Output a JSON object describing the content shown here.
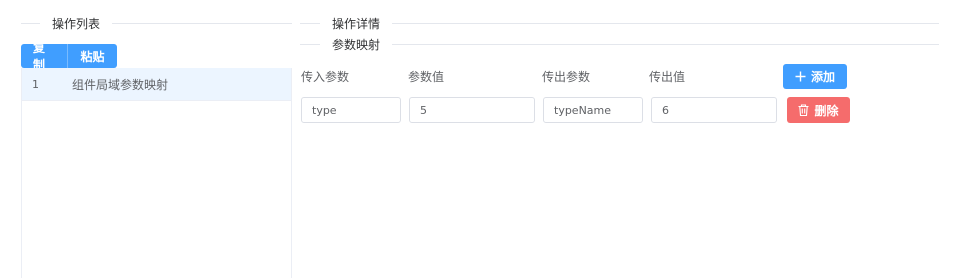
{
  "left": {
    "section_title": "操作列表",
    "copy_label": "复制",
    "paste_label": "粘贴",
    "items": [
      {
        "index": "1",
        "label": "组件局域参数映射"
      }
    ]
  },
  "right": {
    "section_title": "操作详情",
    "sub_title": "参数映射",
    "columns": {
      "in_param": "传入参数",
      "param_value": "参数值",
      "out_param": "传出参数",
      "out_value": "传出值"
    },
    "add_label": "添加",
    "delete_label": "删除",
    "rows": [
      {
        "in_param": "type",
        "param_value": "5",
        "out_param": "typeName",
        "out_value": "6"
      }
    ]
  },
  "colors": {
    "primary": "#409eff",
    "danger": "#f56c6c",
    "selected_row": "#ecf5ff"
  },
  "icons": {
    "add": "plus-icon",
    "delete": "trash-icon"
  }
}
